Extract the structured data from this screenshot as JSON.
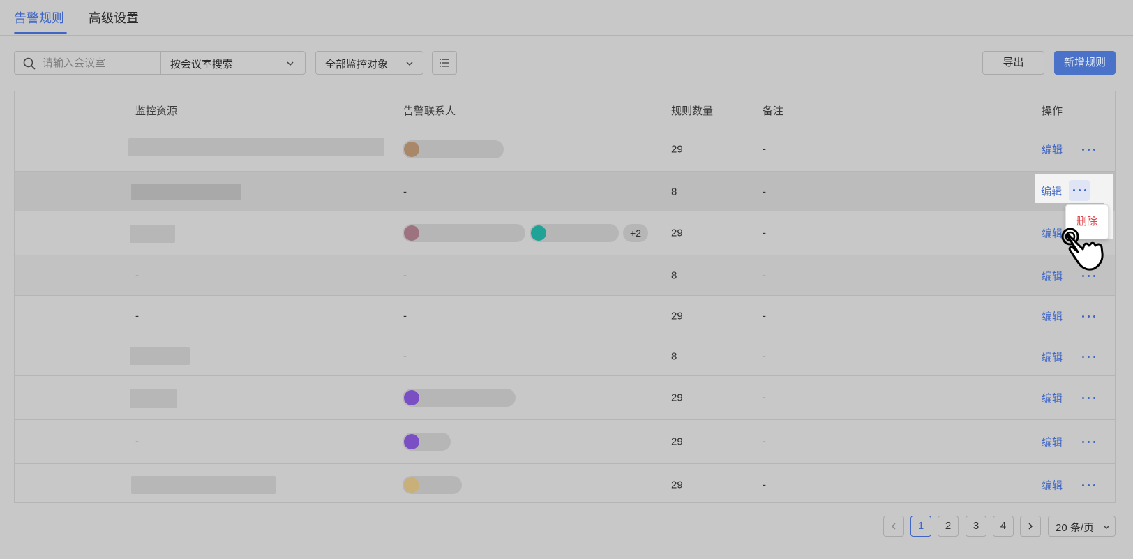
{
  "tabs": [
    {
      "label": "告警规则",
      "active": true
    },
    {
      "label": "高级设置",
      "active": false
    }
  ],
  "toolbar": {
    "search_placeholder": "请输入会议室",
    "search_type": "按会议室搜索",
    "target_filter": "全部监控对象",
    "export_label": "导出",
    "add_label": "新增规则"
  },
  "table": {
    "headers": [
      "监控资源",
      "告警联系人",
      "规则数量",
      "备注",
      "操作"
    ],
    "rows": [
      {
        "resource": "",
        "contacts_text": "",
        "count": "29",
        "note": "-",
        "edit": "编辑"
      },
      {
        "resource": "",
        "contacts_text": "-",
        "count": "8",
        "note": "-",
        "edit": "编辑"
      },
      {
        "resource": "",
        "contacts_text": "",
        "more": "+2",
        "count": "29",
        "note": "-",
        "edit": "编辑"
      },
      {
        "resource": "-",
        "contacts_text": "-",
        "count": "8",
        "note": "-",
        "edit": "编辑"
      },
      {
        "resource": "-",
        "contacts_text": "-",
        "count": "29",
        "note": "-",
        "edit": "编辑"
      },
      {
        "resource": "",
        "contacts_text": "-",
        "count": "8",
        "note": "-",
        "edit": "编辑"
      },
      {
        "resource": "",
        "contacts_text": "",
        "count": "29",
        "note": "-",
        "edit": "编辑"
      },
      {
        "resource": "-",
        "contacts_text": "",
        "count": "29",
        "note": "-",
        "edit": "编辑"
      },
      {
        "resource": "",
        "contacts_text": "",
        "count": "29",
        "note": "-",
        "edit": "编辑"
      }
    ]
  },
  "row_menu": {
    "delete_label": "删除"
  },
  "pagination": {
    "pages": [
      "1",
      "2",
      "3",
      "4"
    ],
    "current": "1",
    "page_size": "20 条/页"
  },
  "colors": {
    "accent": "#3f66c6",
    "danger": "#e0454a",
    "avatar_1": "#a88868",
    "avatar_2": "#9e7380",
    "avatar_3": "#1fa396",
    "avatar_4": "#7a4fc4",
    "avatar_5": "#c9b078"
  }
}
